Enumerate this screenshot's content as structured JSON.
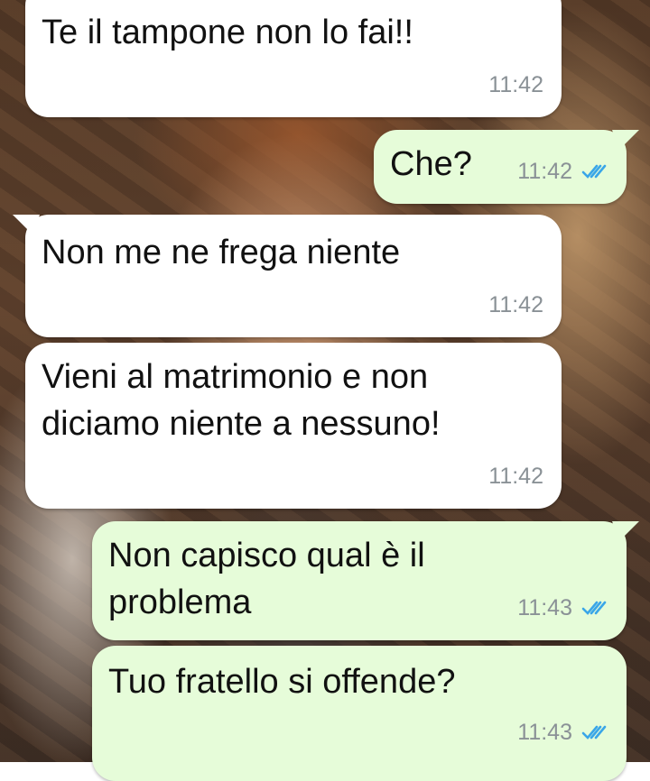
{
  "colors": {
    "incoming_bubble": "#ffffff",
    "outgoing_bubble": "#e6fcd9",
    "timestamp": "#8a9196",
    "read_ticks": "#3aa6e8"
  },
  "messages": [
    {
      "direction": "incoming",
      "text": "Te il tampone non lo fai!!",
      "time": "11:42"
    },
    {
      "direction": "outgoing",
      "text": "Che?",
      "time": "11:42",
      "status": "read"
    },
    {
      "direction": "incoming",
      "text": "Non me ne frega niente",
      "time": "11:42"
    },
    {
      "direction": "incoming",
      "text": "Vieni al matrimonio e non\ndiciamo niente a nessuno!",
      "time": "11:42"
    },
    {
      "direction": "outgoing",
      "text": "Non capisco qual è il\nproblema",
      "time": "11:43",
      "status": "read"
    },
    {
      "direction": "outgoing",
      "text": "Tuo fratello si offende?",
      "time": "11:43",
      "status": "read"
    }
  ]
}
